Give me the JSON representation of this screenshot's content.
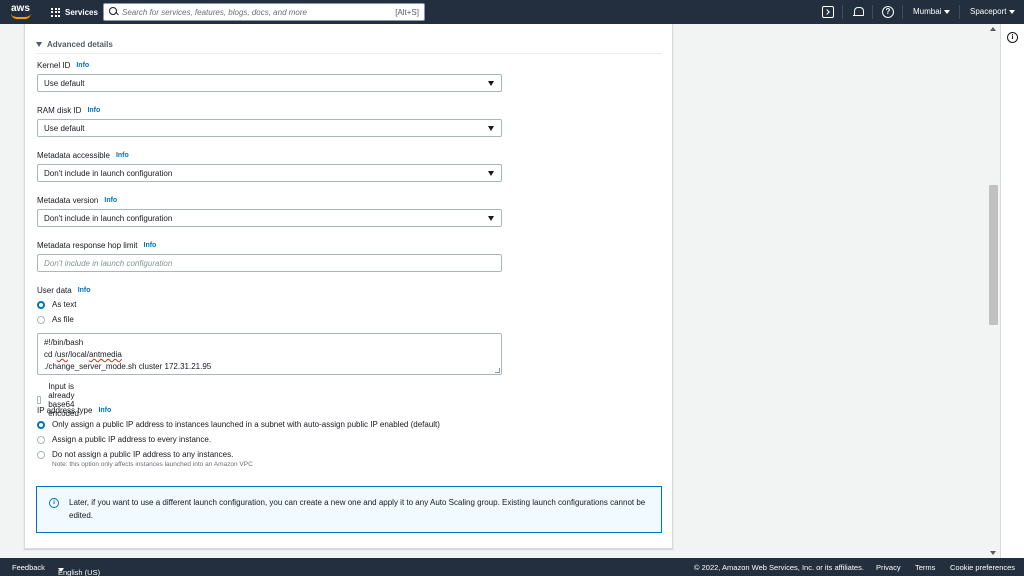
{
  "nav": {
    "logo": "aws",
    "services_label": "Services",
    "search_placeholder": "Search for services, features, blogs, docs, and more",
    "search_shortcut": "[Alt+S]",
    "help_symbol": "?",
    "region": "Mumbai",
    "account": "Spaceport"
  },
  "tools": {
    "info_symbol": "i"
  },
  "section": {
    "title": "Advanced details"
  },
  "fields": {
    "kernel": {
      "label": "Kernel ID",
      "info": "Info",
      "value": "Use default"
    },
    "ramdisk": {
      "label": "RAM disk ID",
      "info": "Info",
      "value": "Use default"
    },
    "metadata_accessible": {
      "label": "Metadata accessible",
      "info": "Info",
      "value": "Don't include in launch configuration"
    },
    "metadata_version": {
      "label": "Metadata version",
      "info": "Info",
      "value": "Don't include in launch configuration"
    },
    "hop_limit": {
      "label": "Metadata response hop limit",
      "info": "Info",
      "placeholder": "Don't include in launch configuration"
    },
    "user_data": {
      "label": "User data",
      "info": "Info",
      "options": [
        "As text",
        "As file"
      ],
      "selected": "As text",
      "line1": "#!/bin/bash",
      "line2_prefix": "cd /",
      "line2_usr": "usr",
      "line2_mid": "/local/",
      "line2_antmedia": "antmedia",
      "line3": "./change_server_mode.sh cluster 172.31.21.95",
      "base64_label": "Input is already base64 encoded"
    },
    "ip_type": {
      "label": "IP address type",
      "info": "Info",
      "options": [
        "Only assign a public IP address to instances launched in a subnet with auto-assign public IP enabled (default)",
        "Assign a public IP address to every instance.",
        "Do not assign a public IP address to any instances."
      ],
      "note": "Note: this option only affects instances launched into an Amazon VPC"
    }
  },
  "alert": {
    "icon_symbol": "i",
    "text": "Later, if you want to use a different launch configuration, you can create a new one and apply it to any Auto Scaling group. Existing launch configurations cannot be edited."
  },
  "footer": {
    "feedback": "Feedback",
    "language": "English (US)",
    "copyright": "© 2022, Amazon Web Services, Inc. or its affiliates.",
    "privacy": "Privacy",
    "terms": "Terms",
    "cookies": "Cookie preferences"
  },
  "colors": {
    "nav_bg": "#232f3e",
    "accent": "#ff9900",
    "link": "#0073bb"
  }
}
